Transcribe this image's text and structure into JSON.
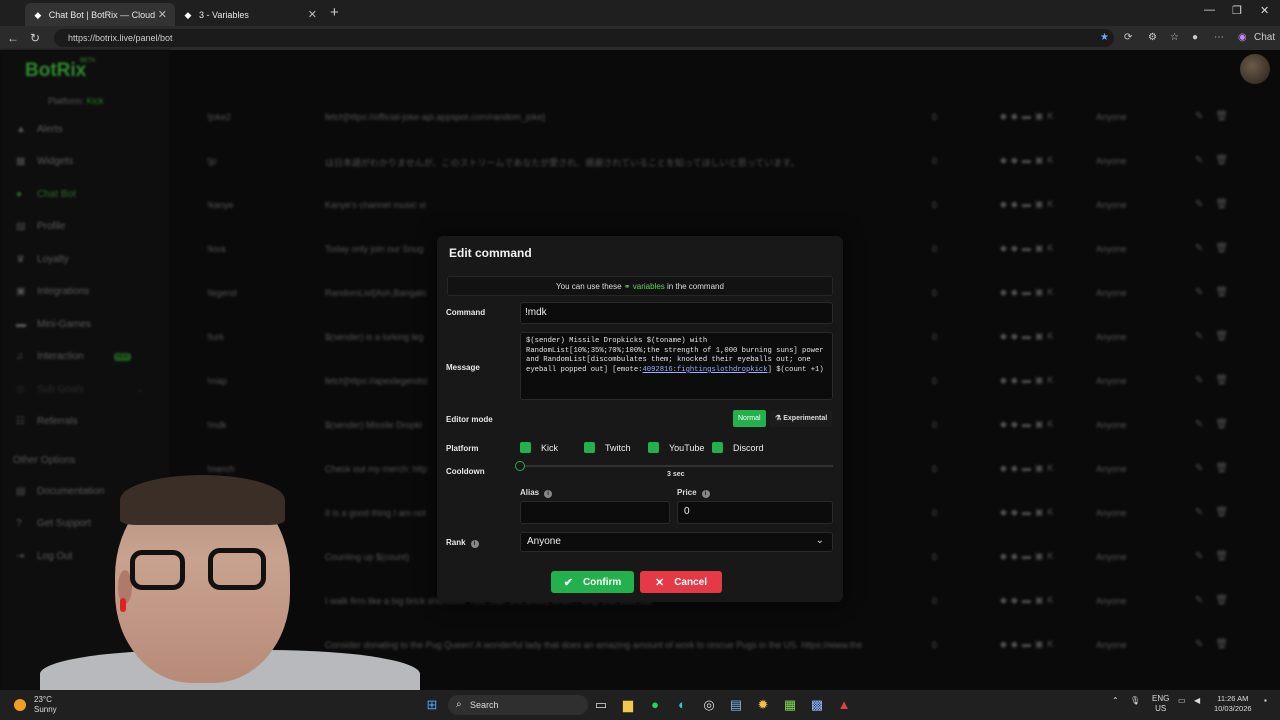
{
  "browser": {
    "tabs": [
      {
        "title": "Chat Bot | BotRix — Cloud Stream",
        "icon": "botrix-favicon"
      },
      {
        "title": "3 - Variables",
        "icon": "botrix-favicon"
      }
    ],
    "url": "https://botrix.live/panel/bot",
    "chat_label": "Chat"
  },
  "sidebar": {
    "logo": "BotRix",
    "beta": "BETA",
    "platform_label": "Platform:",
    "platform_value": "Kick",
    "items": [
      {
        "label": "Alerts",
        "icon": "warning-icon"
      },
      {
        "label": "Widgets",
        "icon": "grid-icon"
      },
      {
        "label": "Chat Bot",
        "icon": "chat-icon"
      },
      {
        "label": "Profile",
        "icon": "profile-icon"
      },
      {
        "label": "Loyalty",
        "icon": "trophy-icon"
      },
      {
        "label": "Integrations",
        "icon": "puzzle-icon"
      },
      {
        "label": "Mini-Games",
        "icon": "gamepad-icon"
      },
      {
        "label": "Interaction",
        "icon": "music-icon"
      },
      {
        "label": "Sub Goals",
        "icon": "target-icon"
      },
      {
        "label": "Referrals",
        "icon": "users-icon"
      }
    ],
    "other_options_label": "Other Options",
    "other_items": [
      {
        "label": "Documentation",
        "icon": "book-icon"
      },
      {
        "label": "Get Support",
        "icon": "help-icon"
      },
      {
        "label": "Log Out",
        "icon": "logout-icon"
      }
    ],
    "new_badge": "NEW"
  },
  "table": {
    "rows": [
      {
        "name": "!joke2",
        "response": "fetch[https://official-joke-api.appspot.com/random_joke]",
        "count": "0",
        "rank": "Anyone"
      },
      {
        "name": "!jp",
        "response": "は日本語がわかりませんが、このストリームであなたが愛され、感謝されていることを知ってほしいと思っています。",
        "count": "0",
        "rank": "Anyone"
      },
      {
        "name": "!kanye",
        "response": "Kanye's channel music vi",
        "count": "0",
        "rank": "Anyone"
      },
      {
        "name": "!kiva",
        "response": "Today only join our Snug",
        "count": "0",
        "rank": "Anyone"
      },
      {
        "name": "!legend",
        "response": "RandomList[Ash,Bangalo",
        "count": "0",
        "rank": "Anyone"
      },
      {
        "name": "!lurk",
        "response": "$(sender) is a lurking leg",
        "count": "0",
        "rank": "Anyone"
      },
      {
        "name": "!map",
        "response": "fetch[https://apexlegendst",
        "count": "0",
        "rank": "Anyone"
      },
      {
        "name": "!mdk",
        "response": "$(sender) Missile Dropki",
        "count": "0",
        "rank": "Anyone"
      },
      {
        "name": "!merch",
        "response": "Check out my merch: http",
        "count": "0",
        "rank": "Anyone"
      },
      {
        "name": "!mi",
        "response": "It is a good thing I am not",
        "count": "0",
        "rank": "Anyone"
      },
      {
        "name": "!mo",
        "response": "Counting up $(count)",
        "count": "0",
        "rank": "Anyone"
      },
      {
        "name": "!mp",
        "response": "I walk firm like a big brick shithouse Your man shit bricks when I whip that stick out",
        "count": "0",
        "rank": "Anyone"
      },
      {
        "name": "!pug",
        "response": "Consider donating to the Pug Queen! A wonderful lady that does an amazing amount of work to rescue Pugs in the US. https://www.the",
        "count": "0",
        "rank": "Anyone"
      }
    ]
  },
  "modal": {
    "title": "Edit command",
    "info_prefix": "You can use these",
    "info_link": "variables",
    "info_suffix": "in the command",
    "command_label": "Command",
    "command_value": "!mdk",
    "message_label": "Message",
    "message_part1": "$(sender) Missile Dropkicks $(toname) with RandomList[10%;35%;70%;100%;the strength of 1,000 burning suns] power and RandomList[discombulates them; knocked their eyeballs out; one eyeball popped out] [emote:",
    "message_emote": "4092816:fightingslothdropkick",
    "message_part2": "] $(count +1)",
    "editor_mode_label": "Editor mode",
    "mode_normal": "Normal",
    "mode_experimental": "Experimental",
    "platform_label": "Platform",
    "platforms": [
      "Kick",
      "Twitch",
      "YouTube",
      "Discord"
    ],
    "cooldown_label": "Cooldown",
    "cooldown_value": "3 sec",
    "cooldown_fraction": 0.0,
    "alias_label": "Alias",
    "alias_value": "",
    "price_label": "Price",
    "price_value": "0",
    "rank_label": "Rank",
    "rank_value": "Anyone",
    "confirm_label": "Confirm",
    "cancel_label": "Cancel"
  },
  "taskbar": {
    "temp": "23°C",
    "weather": "Sunny",
    "search": "Search",
    "lang": "ENG",
    "region": "US",
    "time": "11:26 AM",
    "date": "10/03/2026"
  },
  "colors": {
    "accent": "#22b14c",
    "danger": "#e53945"
  }
}
